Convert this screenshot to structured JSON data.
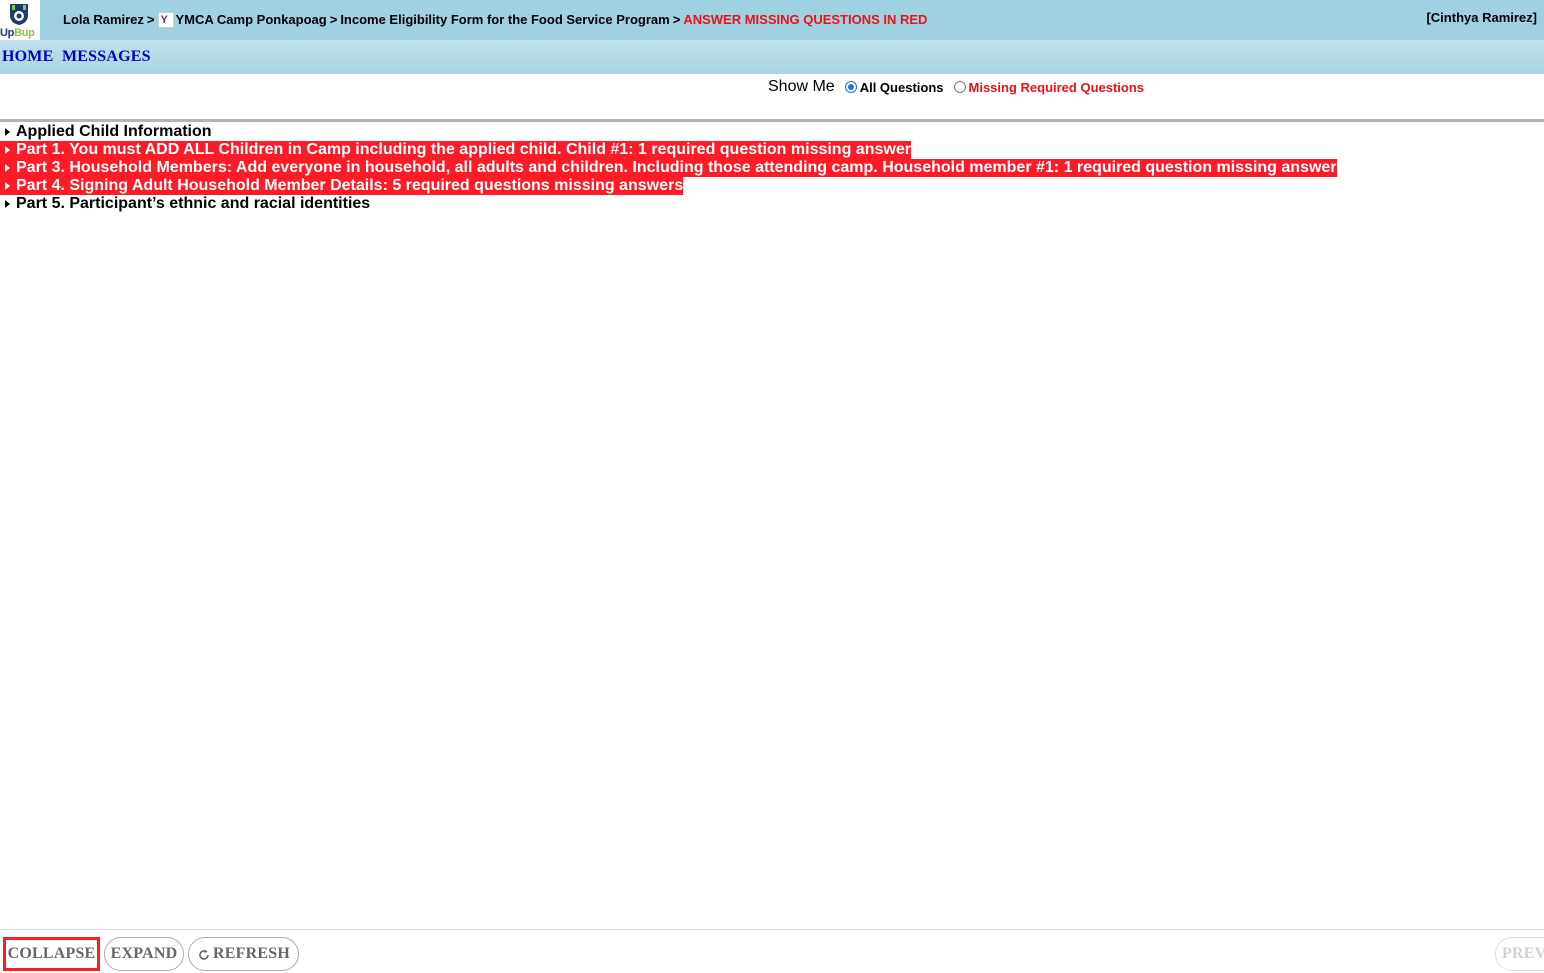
{
  "header": {
    "brand_left": "Up",
    "brand_right": "Bup",
    "breadcrumb": [
      "Lola Ramirez",
      "YMCA Camp Ponkapoag",
      "Income Eligibility Form for the Food Service Program"
    ],
    "breadcrumb_separator": ">",
    "breadcrumb_alert": "ANSWER MISSING QUESTIONS IN RED",
    "user": "[Cinthya Ramirez]",
    "colors": {
      "header_bg": "#9fd1e0",
      "alert": "#e8121a"
    }
  },
  "nav": {
    "home": "HOME",
    "messages": "MESSAGES"
  },
  "filter": {
    "label": "Show Me",
    "options": [
      {
        "label": "All Questions",
        "selected": true
      },
      {
        "label": "Missing Required Questions",
        "selected": false
      }
    ]
  },
  "sections": [
    {
      "title": "Applied Child Information",
      "missing": false
    },
    {
      "title": "Part 1. You must ADD ALL Children in Camp including the applied child. Child #1: 1 required question missing answer",
      "missing": true
    },
    {
      "title": "Part 3. Household Members: Add everyone in household, all adults and children. Including those attending camp. Household member #1: 1 required question missing answer",
      "missing": true
    },
    {
      "title": "Part 4. Signing Adult Household Member Details: 5 required questions missing answers",
      "missing": true
    },
    {
      "title": "Part 5. Participant’s ethnic and racial identities",
      "missing": false
    }
  ],
  "footer": {
    "collapse": "COLLAPSE",
    "expand": "EXPAND",
    "refresh": "REFRESH",
    "prev": "PREV"
  }
}
